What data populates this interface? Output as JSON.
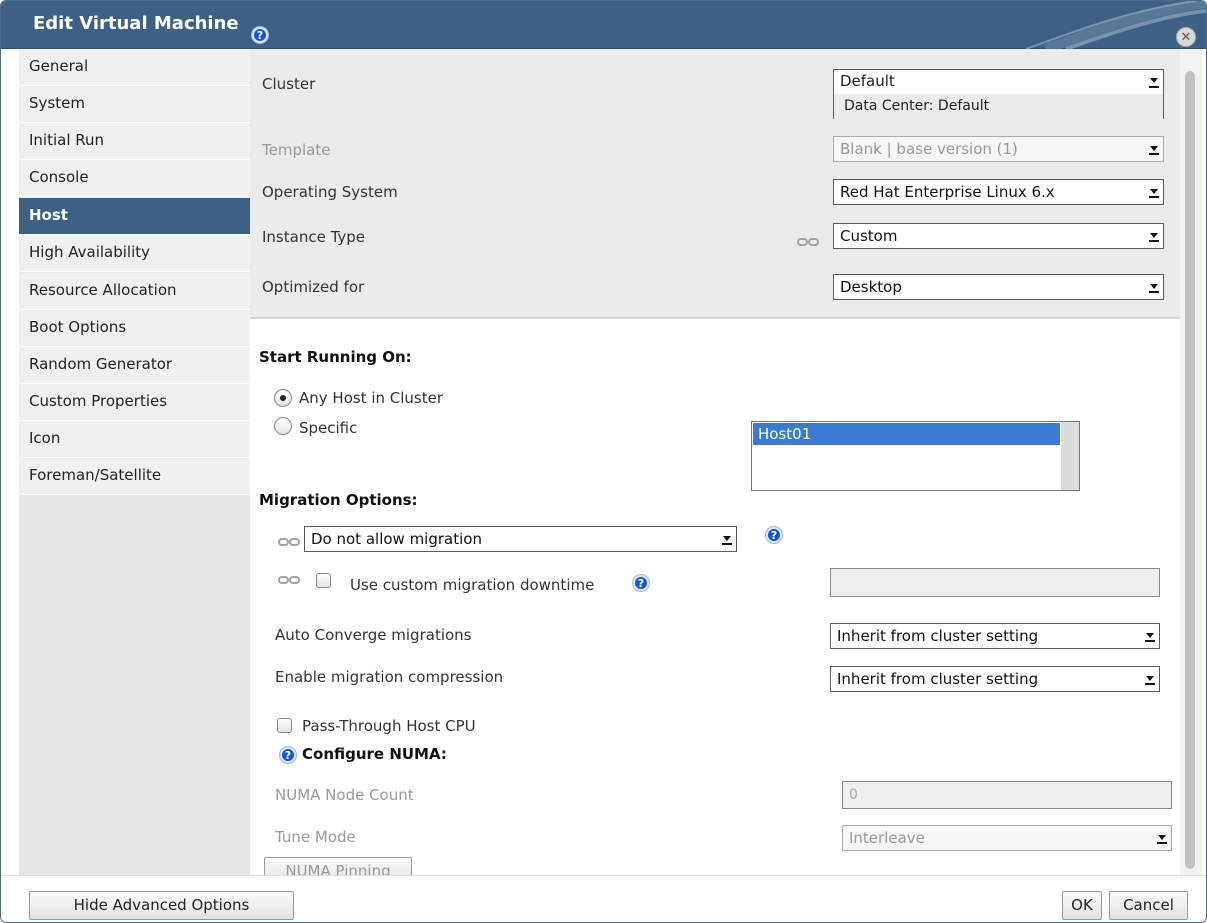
{
  "title": "Edit Virtual Machine",
  "sidebar": {
    "items": [
      {
        "label": "General"
      },
      {
        "label": "System"
      },
      {
        "label": "Initial Run"
      },
      {
        "label": "Console"
      },
      {
        "label": "Host",
        "selected": true
      },
      {
        "label": "High Availability"
      },
      {
        "label": "Resource Allocation"
      },
      {
        "label": "Boot Options"
      },
      {
        "label": "Random Generator"
      },
      {
        "label": "Custom Properties"
      },
      {
        "label": "Icon"
      },
      {
        "label": "Foreman/Satellite"
      }
    ]
  },
  "general": {
    "cluster_label": "Cluster",
    "cluster_value": "Default",
    "data_center": "Data Center: Default",
    "template_label": "Template",
    "template_value": "Blank | base version (1)",
    "os_label": "Operating System",
    "os_value": "Red Hat Enterprise Linux 6.x",
    "instance_type_label": "Instance Type",
    "instance_type_value": "Custom",
    "optimized_label": "Optimized for",
    "optimized_value": "Desktop"
  },
  "host": {
    "start_running_heading": "Start Running On:",
    "any_host_label": "Any Host in Cluster",
    "specific_label": "Specific",
    "selected_option": "any_host",
    "hosts": [
      "Host01"
    ]
  },
  "migration": {
    "heading": "Migration Options:",
    "mode_value": "Do not allow migration",
    "custom_downtime_label": "Use custom migration downtime",
    "custom_downtime_checked": false,
    "auto_converge_label": "Auto Converge migrations",
    "auto_converge_value": "Inherit from cluster setting",
    "compression_label": "Enable migration compression",
    "compression_value": "Inherit from cluster setting",
    "passthrough_label": "Pass-Through Host CPU",
    "passthrough_checked": false
  },
  "numa": {
    "heading": "Configure NUMA:",
    "node_count_label": "NUMA Node Count",
    "node_count_value": "0",
    "tune_mode_label": "Tune Mode",
    "tune_mode_value": "Interleave",
    "pinning_button": "NUMA Pinning"
  },
  "footer": {
    "hide_advanced": "Hide Advanced Options",
    "ok": "OK",
    "cancel": "Cancel"
  },
  "colors": {
    "titlebar": "#3d6184",
    "selected_tab": "#3d6184",
    "list_selection": "#3b7bd4",
    "help_icon": "#1555d3"
  }
}
